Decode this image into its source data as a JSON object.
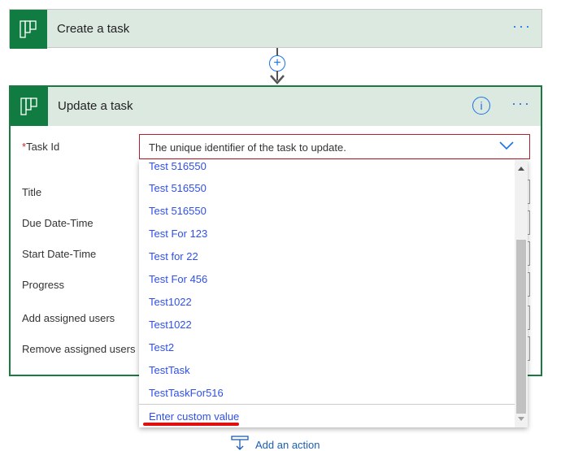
{
  "card1": {
    "title": "Create a task",
    "more": "···",
    "icon": "planner-icon"
  },
  "card2": {
    "title": "Update a task",
    "more": "···",
    "info": "i",
    "icon": "planner-icon",
    "fields": [
      {
        "label": "Task Id",
        "required": "*"
      },
      {
        "label": "Title"
      },
      {
        "label": "Due Date-Time"
      },
      {
        "label": "Start Date-Time"
      },
      {
        "label": "Progress"
      },
      {
        "label": "Add assigned users"
      },
      {
        "label": "Remove assigned users"
      }
    ],
    "task_id_placeholder": "The unique identifier of the task to update."
  },
  "dropdown": {
    "items": [
      "Test 516550",
      "Test 516550",
      "Test 516550",
      "Test For 123",
      "Test for 22",
      "Test For 456",
      "Test1022",
      "Test1022",
      "Test2",
      "TestTask",
      "TestTaskFor516"
    ],
    "custom": "Enter custom value"
  },
  "add_action": "Add an action",
  "colors": {
    "accent": "#107c41",
    "link": "#2f50e8",
    "error": "#b3202c",
    "annotation": "#e01010"
  }
}
